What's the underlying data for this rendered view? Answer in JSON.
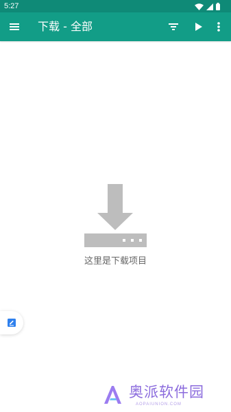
{
  "status_bar": {
    "time": "5:27",
    "icons": [
      "wifi-icon",
      "signal-icon",
      "battery-icon"
    ]
  },
  "toolbar": {
    "title": "下载 - 全部",
    "menu_icon": "menu-icon",
    "filter_icon": "filter-icon",
    "play_icon": "play-icon",
    "more_icon": "more-vertical-icon"
  },
  "empty_state": {
    "icon": "download-icon",
    "message": "这里是下载项目"
  },
  "floating_tab": {
    "icon": "edit-note-icon"
  },
  "watermark": {
    "name": "奥派软件园",
    "sub": "AOPAIUNION.COM"
  },
  "colors": {
    "status_bar": "#0f8a77",
    "toolbar": "#129d87",
    "empty_icon": "#bdbdbd",
    "empty_text": "#666666",
    "accent_blue": "#2f80ed",
    "watermark": "#8b6bdd"
  }
}
